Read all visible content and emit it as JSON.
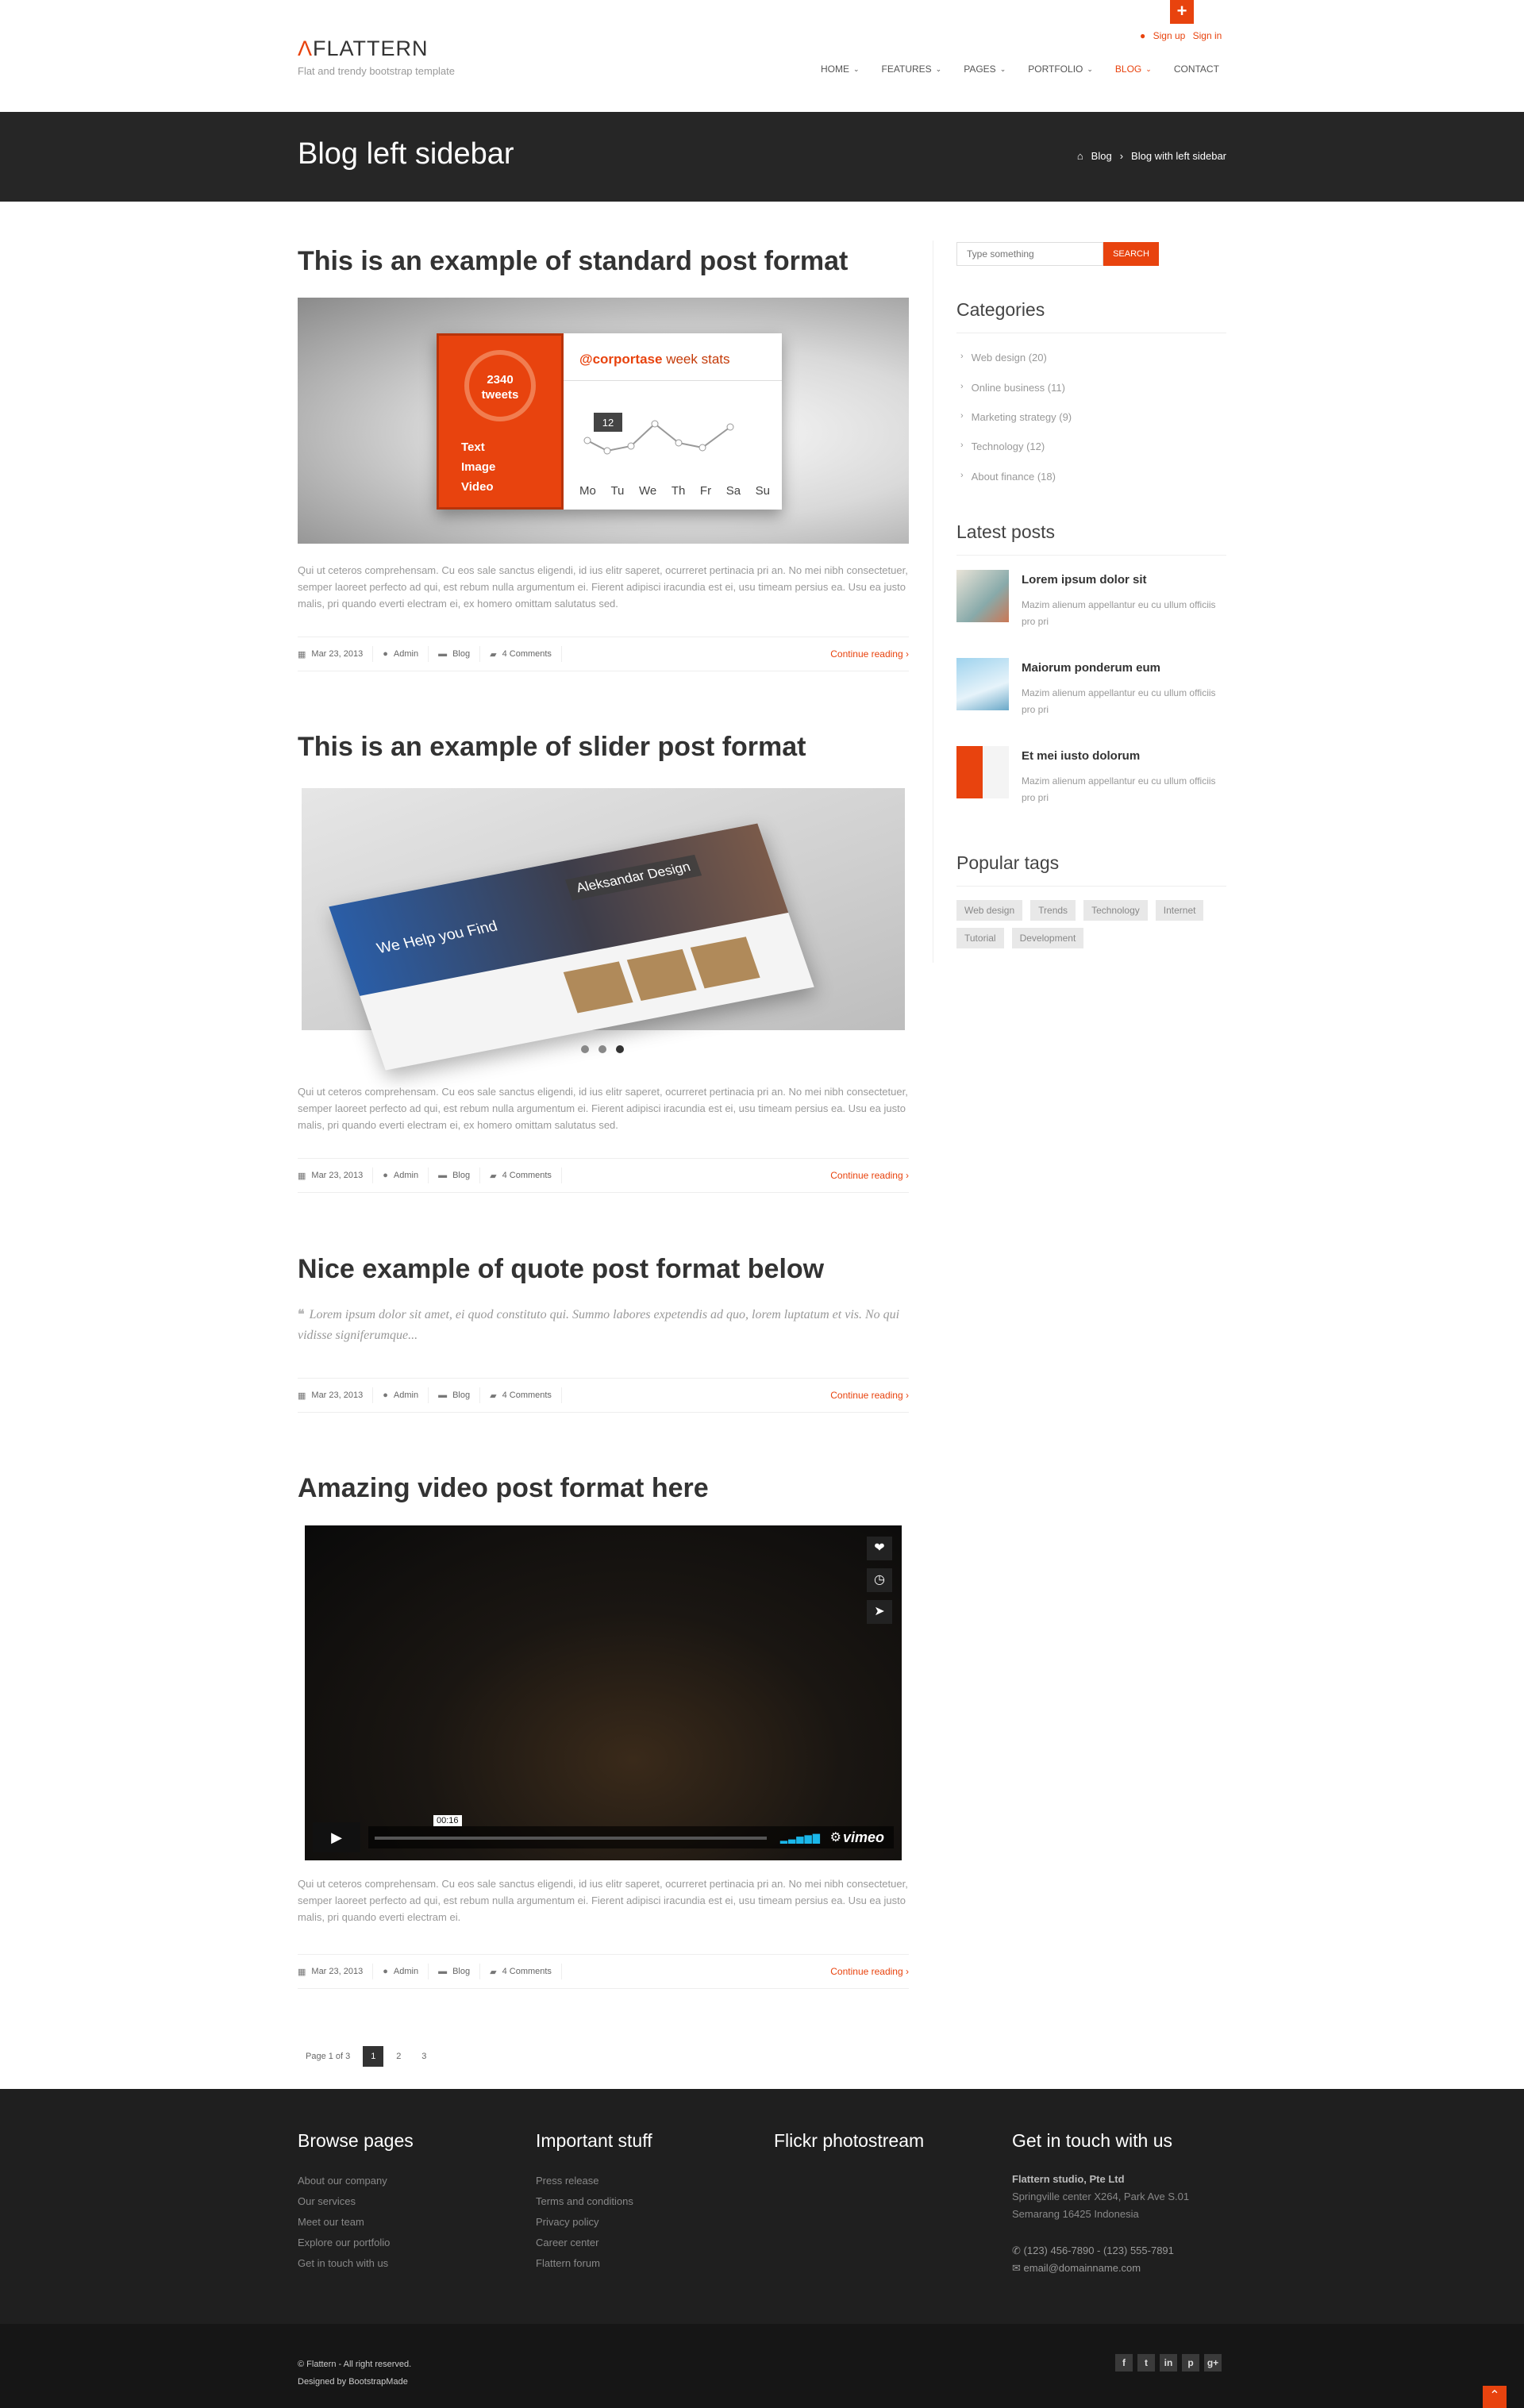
{
  "header": {
    "logo_mark": "Λ",
    "logo_text": "FLATTERN",
    "tagline": "Flat and trendy bootstrap template",
    "plus": "+",
    "sign_up": "Sign up",
    "sign_in": "Sign in",
    "nav": [
      {
        "label": "HOME",
        "caret": "⌄"
      },
      {
        "label": "FEATURES",
        "caret": "⌄"
      },
      {
        "label": "PAGES",
        "caret": "⌄"
      },
      {
        "label": "PORTFOLIO",
        "caret": "⌄"
      },
      {
        "label": "BLOG",
        "caret": "⌄"
      },
      {
        "label": "CONTACT",
        "caret": ""
      }
    ],
    "active_nav": "BLOG"
  },
  "titlebar": {
    "title": "Blog left sidebar",
    "breadcrumb": [
      "Blog",
      "Blog with left sidebar"
    ]
  },
  "posts": [
    {
      "title": "This is an example of standard post format",
      "text": "Qui ut ceteros comprehensam. Cu eos sale sanctus eligendi, id ius elitr saperet, ocurreret pertinacia pri an. No mei nibh consectetuer, semper laoreet perfecto ad qui, est rebum nulla argumentum ei. Fierent adipisci iracundia est ei, usu timeam persius ea. Usu ea justo malis, pri quando everti electram ei, ex homero omittam salutatus sed.",
      "date": "Mar 23, 2013",
      "author": "Admin",
      "category": "Blog",
      "comments": "4 Comments",
      "more": "Continue reading"
    },
    {
      "title": "This is an example of slider post format",
      "text": "Qui ut ceteros comprehensam. Cu eos sale sanctus eligendi, id ius elitr saperet, ocurreret pertinacia pri an. No mei nibh consectetuer, semper laoreet perfecto ad qui, est rebum nulla argumentum ei. Fierent adipisci iracundia est ei, usu timeam persius ea. Usu ea justo malis, pri quando everti electram ei, ex homero omittam salutatus sed.",
      "date": "Mar 23, 2013",
      "author": "Admin",
      "category": "Blog",
      "comments": "4 Comments",
      "more": "Continue reading"
    },
    {
      "title": "Nice example of quote post format below",
      "quote": "Lorem ipsum dolor sit amet, ei quod constituto qui. Summo labores expetendis ad quo, lorem luptatum et vis. No qui vidisse signiferumque...",
      "date": "Mar 23, 2013",
      "author": "Admin",
      "category": "Blog",
      "comments": "4 Comments",
      "more": "Continue reading"
    },
    {
      "title": "Amazing video post format here",
      "text": "Qui ut ceteros comprehensam. Cu eos sale sanctus eligendi, id ius elitr saperet, ocurreret pertinacia pri an. No mei nibh consectetuer, semper laoreet perfecto ad qui, est rebum nulla argumentum ei. Fierent adipisci iracundia est ei, usu timeam persius ea. Usu ea justo malis, pri quando everti electram ei.",
      "date": "Mar 23, 2013",
      "author": "Admin",
      "category": "Blog",
      "comments": "4 Comments",
      "more": "Continue reading"
    }
  ],
  "stats_image": {
    "tweets_count": "2340",
    "tweets_label": "tweets",
    "legend": [
      "Text",
      "Image",
      "Video"
    ],
    "handle": "@corportase",
    "stats_label": "week stats",
    "tooltip": "12",
    "days": [
      "Mo",
      "Tu",
      "We",
      "Th",
      "Fr",
      "Sa",
      "Su"
    ]
  },
  "slider_image": {
    "heading": "We Help you Find",
    "subheading": "Aleksandar Design"
  },
  "slider": {
    "slide_count": 3,
    "active_index": 2
  },
  "video": {
    "time": "00:16",
    "brand": "vimeo",
    "side_icons": [
      "heart-icon",
      "clock-icon",
      "send-icon"
    ]
  },
  "pagination": {
    "info": "Page 1 of 3",
    "pages": [
      "1",
      "2",
      "3"
    ],
    "current": "1"
  },
  "sidebar": {
    "search_placeholder": "Type something",
    "search_button": "SEARCH",
    "categories_heading": "Categories",
    "categories": [
      {
        "name": "Web design",
        "count": "(20)"
      },
      {
        "name": "Online business",
        "count": "(11)"
      },
      {
        "name": "Marketing strategy",
        "count": "(9)"
      },
      {
        "name": "Technology",
        "count": "(12)"
      },
      {
        "name": "About finance",
        "count": "(18)"
      }
    ],
    "latest_heading": "Latest posts",
    "latest": [
      {
        "title": "Lorem ipsum dolor sit",
        "excerpt": "Mazim alienum appellantur eu cu ullum officiis pro pri"
      },
      {
        "title": "Maiorum ponderum eum",
        "excerpt": "Mazim alienum appellantur eu cu ullum officiis pro pri"
      },
      {
        "title": "Et mei iusto dolorum",
        "excerpt": "Mazim alienum appellantur eu cu ullum officiis pro pri"
      }
    ],
    "tags_heading": "Popular tags",
    "tags": [
      "Web design",
      "Trends",
      "Technology",
      "Internet",
      "Tutorial",
      "Development"
    ]
  },
  "footer": {
    "browse_heading": "Browse pages",
    "browse": [
      "About our company",
      "Our services",
      "Meet our team",
      "Explore our portfolio",
      "Get in touch with us"
    ],
    "important_heading": "Important stuff",
    "important": [
      "Press release",
      "Terms and conditions",
      "Privacy policy",
      "Career center",
      "Flattern forum"
    ],
    "flickr_heading": "Flickr photostream",
    "contact_heading": "Get in touch with us",
    "company": "Flattern studio, Pte Ltd",
    "address_1": "Springville center X264, Park Ave S.01",
    "address_2": "Semarang 16425 Indonesia",
    "phone": "(123) 456-7890 - (123) 555-7891",
    "email": "email@domainname.com"
  },
  "subfooter": {
    "copyright": "© Flattern - All right reserved.",
    "designed_by": "Designed by BootstrapMade",
    "social": [
      "f",
      "t",
      "in",
      "p",
      "g+"
    ]
  },
  "colors": {
    "accent": "#e8430e",
    "dark": "#262626",
    "footer": "#1f1f1f"
  }
}
